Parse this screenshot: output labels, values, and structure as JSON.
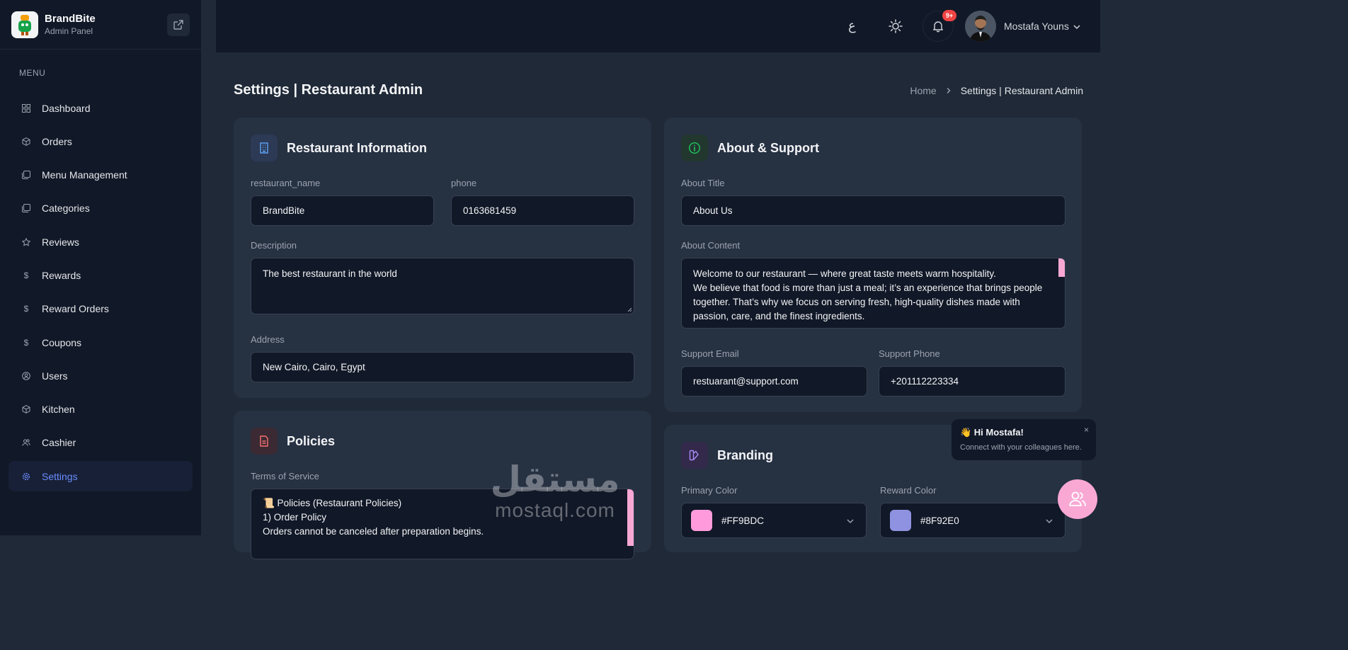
{
  "brand": {
    "name": "BrandBite",
    "subtitle": "Admin Panel"
  },
  "sidebar": {
    "heading": "MENU",
    "items": [
      {
        "label": "Dashboard",
        "icon": "grid-icon"
      },
      {
        "label": "Orders",
        "icon": "box-icon"
      },
      {
        "label": "Menu Management",
        "icon": "copy-icon"
      },
      {
        "label": "Categories",
        "icon": "copy-icon"
      },
      {
        "label": "Reviews",
        "icon": "star-icon"
      },
      {
        "label": "Rewards",
        "icon": "dollar-icon"
      },
      {
        "label": "Reward Orders",
        "icon": "dollar-icon"
      },
      {
        "label": "Coupons",
        "icon": "dollar-icon"
      },
      {
        "label": "Users",
        "icon": "user-circle-icon"
      },
      {
        "label": "Kitchen",
        "icon": "box-icon"
      },
      {
        "label": "Cashier",
        "icon": "users-icon"
      },
      {
        "label": "Settings",
        "icon": "gear-icon",
        "active": true
      }
    ]
  },
  "topbar": {
    "lang_label": "ع",
    "notification_badge": "9+",
    "user_name": "Mostafa Youns"
  },
  "page": {
    "title": "Settings | Restaurant Admin",
    "breadcrumb": {
      "home": "Home",
      "current": "Settings | Restaurant Admin"
    }
  },
  "restaurant_info": {
    "title": "Restaurant Information",
    "restaurant_name_label": "restaurant_name",
    "restaurant_name_value": "BrandBite",
    "phone_label": "phone",
    "phone_value": "0163681459",
    "description_label": "Description",
    "description_value": "The best restaurant in the world",
    "address_label": "Address",
    "address_value": "New Cairo, Cairo, Egypt"
  },
  "about_support": {
    "title": "About & Support",
    "about_title_label": "About Title",
    "about_title_value": "About Us",
    "about_content_label": "About Content",
    "about_content_lines": [
      "Welcome to our restaurant — where great taste meets warm hospitality.",
      "We believe that food is more than just a meal; it’s an experience that brings people",
      "together. That’s why we focus on serving fresh, high-quality dishes made with",
      "passion, care, and the finest ingredients."
    ],
    "support_email_label": "Support Email",
    "support_email_value": "restuarant@support.com",
    "support_phone_label": "Support Phone",
    "support_phone_value": "+201112223334"
  },
  "policies": {
    "title": "Policies",
    "terms_label": "Terms of Service",
    "terms_lines": [
      "📜 Policies (Restaurant Policies)",
      "1) Order Policy",
      "Orders cannot be canceled after preparation begins."
    ]
  },
  "branding": {
    "title": "Branding",
    "primary_color_label": "Primary Color",
    "primary_color_value": "#FF9BDC",
    "reward_color_label": "Reward Color",
    "reward_color_value": "#8F92E0"
  },
  "toast": {
    "title": "👋 Hi Mostafa!",
    "message": "Connect with your colleagues here.",
    "close": "×"
  },
  "watermark": {
    "arabic": "مستقل",
    "latin": "mostaql.com"
  }
}
